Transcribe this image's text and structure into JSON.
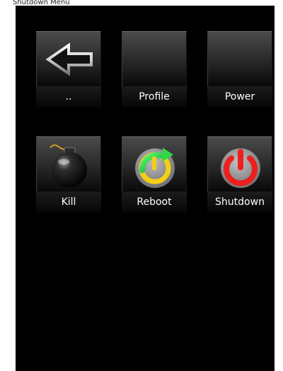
{
  "window": {
    "title": "Shutdown Menu"
  },
  "menu": {
    "items": [
      {
        "label": "..",
        "icon": "back-arrow-icon"
      },
      {
        "label": "Profile",
        "icon": "blank-icon"
      },
      {
        "label": "Power",
        "icon": "blank-icon"
      },
      {
        "label": "Kill",
        "icon": "bomb-icon"
      },
      {
        "label": "Reboot",
        "icon": "reboot-icon"
      },
      {
        "label": "Shutdown",
        "icon": "power-icon"
      }
    ]
  },
  "colors": {
    "screen_bg": "#000000",
    "reboot_green": "#22c55e",
    "reboot_yellow": "#facc15",
    "shutdown_red": "#ef1e1e"
  }
}
